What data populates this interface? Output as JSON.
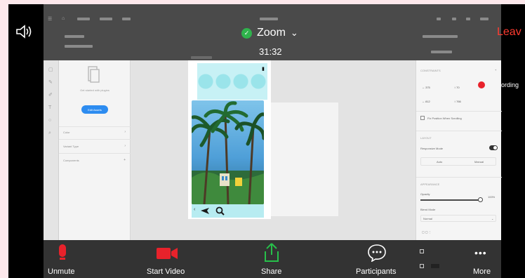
{
  "zoom": {
    "title": "Zoom",
    "timer": "31:32",
    "leave_label": "Leav",
    "recording_label": "ording",
    "toolbar": {
      "unmute": "Unmute",
      "start_video": "Start Video",
      "share": "Share",
      "participants": "Participants",
      "more": "More"
    }
  },
  "colors": {
    "shield": "#2fb24c",
    "leave": "#ff3b30",
    "share_green": "#27c04a",
    "red_icon": "#e8222b",
    "figma_blue": "#2d8cf0"
  },
  "figma": {
    "left_panel": {
      "empty_text": "Get started with plugins",
      "button_label": "Edit Assets",
      "sections": [
        "Color",
        "Variant Type",
        "Components"
      ]
    },
    "right_panel": {
      "checkbox_label": "Fix Position When Scrolling",
      "responsive_label": "Responsive Mode",
      "buttons": [
        "Auto",
        "Manual"
      ],
      "opacity_value": "100%",
      "blend_value": "Normal"
    },
    "phone": {
      "bottom_icons": [
        "plane-icon",
        "search-icon"
      ]
    }
  }
}
